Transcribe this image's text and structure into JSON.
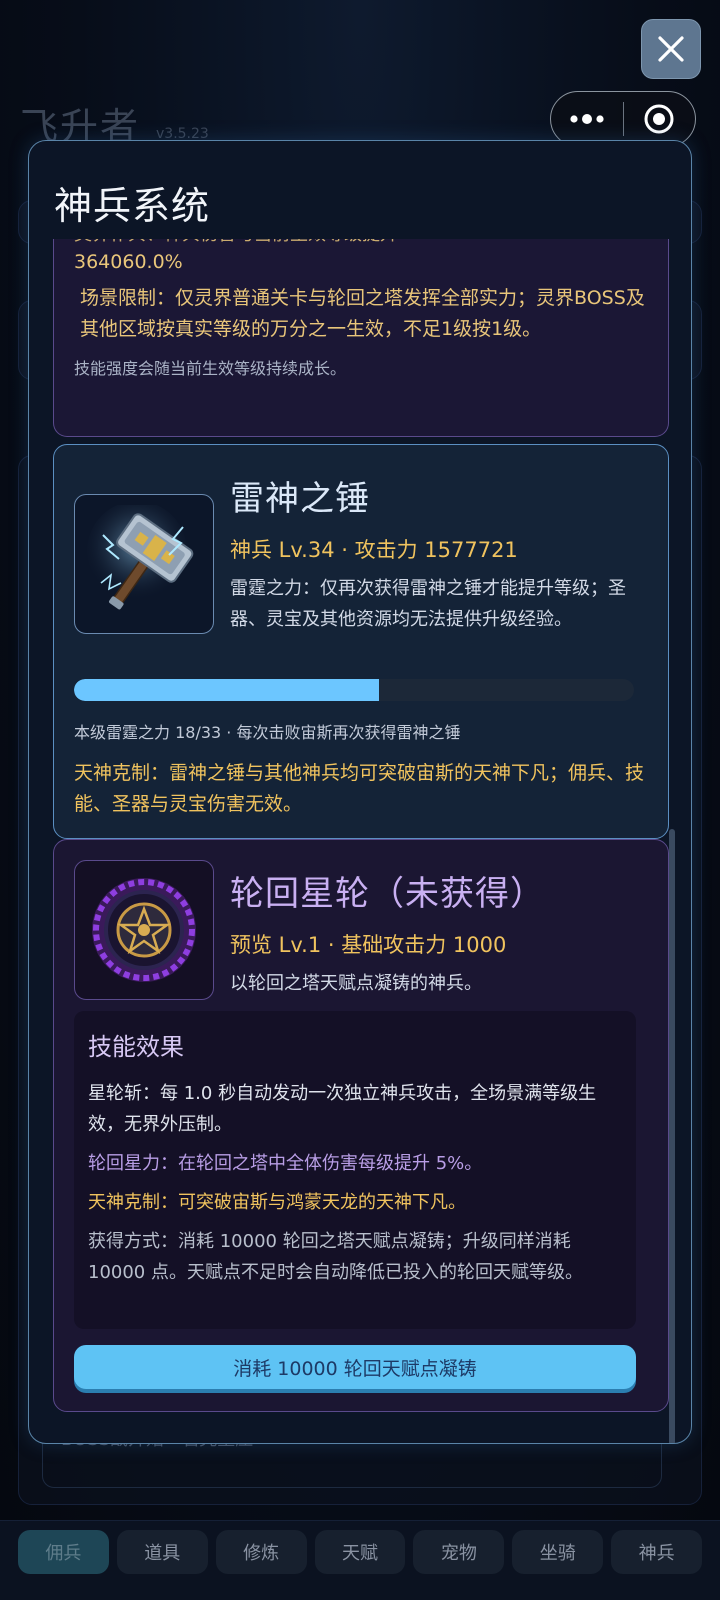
{
  "background": {
    "game_title": "飞升者",
    "version": "v3.5.23",
    "boss_row_text": "BOSS战开始 · 岩壳重压",
    "nav_tabs": [
      "佣兵",
      "道具",
      "修炼",
      "天赋",
      "宠物",
      "坐骑",
      "神兵"
    ],
    "active_tab": "佣兵"
  },
  "controls": {
    "close_icon": "close-icon",
    "more_icon": "more-dots-icon",
    "capsule_target_icon": "target-icon"
  },
  "modal": {
    "title": "神兵系统",
    "previous_card": {
      "cut_text": "灵界仆兵、神兵伤害与当前生效等级提升",
      "bonus_value": "364060.0%",
      "scene_limit": "场景限制：仅灵界普通关卡与轮回之塔发挥全部实力；灵界BOSS及其他区域按真实等级的万分之一生效，不足1级按1级。",
      "growth_note": "技能强度会随当前生效等级持续成长。"
    },
    "hammer": {
      "name": "雷神之锤",
      "stats": "神兵 Lv.34 · 攻击力 1577721",
      "description": "雷霆之力：仅再次获得雷神之锤才能提升等级；圣器、灵宝及其他资源均无法提供升级经验。",
      "progress": 0.545,
      "level_info": "本级雷霆之力 18/33 · 每次击败宙斯再次获得雷神之锤",
      "counter_text": "天神克制：雷神之锤与其他神兵均可突破宙斯的天神下凡；佣兵、技能、圣器与灵宝伤害无效。"
    },
    "wheel": {
      "name": "轮回星轮（未获得）",
      "stats": "预览 Lv.1 · 基础攻击力 1000",
      "description": "以轮回之塔天赋点凝铸的神兵。",
      "effects_title": "技能效果",
      "effect_1": "星轮斩：每 1.0 秒自动发动一次独立神兵攻击，全场景满等级生效，无界外压制。",
      "effect_2": "轮回星力：在轮回之塔中全体伤害每级提升 5%。",
      "effect_3": "天神克制：可突破宙斯与鸿蒙天龙的天神下凡。",
      "effect_4": "获得方式：消耗 10000 轮回之塔天赋点凝铸；升级同样消耗 10000 点。天赋点不足时会自动降低已投入的轮回天赋等级。",
      "forge_button": "消耗 10000 轮回天赋点凝铸"
    }
  },
  "colors": {
    "accent_blue": "#5ec3f4",
    "gold_text": "#f0c35e",
    "purple_text": "#c9b0f2",
    "modal_bg": "#0c1526"
  }
}
